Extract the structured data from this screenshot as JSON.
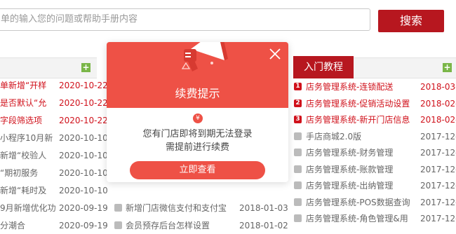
{
  "search": {
    "placeholder": "单的输入您的问题或帮助手册内容",
    "button_label": "搜索"
  },
  "left_panel": {
    "rows": [
      {
        "title": "单新增“开样",
        "date": "2020-10-22",
        "highlight": true
      },
      {
        "title": "是否默认“允",
        "date": "2020-10-22",
        "highlight": true
      },
      {
        "title": "字段筛选项",
        "date": "2020-10-22",
        "highlight": true
      },
      {
        "title": "小程序10月新",
        "date": "2020-10-10",
        "highlight": false
      },
      {
        "title": "新增“校验人",
        "date": "2020-10-10",
        "highlight": false
      },
      {
        "title": "“期初服务",
        "date": "2020-10-10",
        "highlight": false
      },
      {
        "title": "新增“耗时及",
        "date": "2020-10-10",
        "highlight": false
      },
      {
        "title": "9月新增优化功",
        "date": "2020-09-19",
        "highlight": false
      },
      {
        "title": "分潮合",
        "date": "2020-09-19",
        "highlight": false
      }
    ]
  },
  "middle_panel": {
    "rows": [
      {
        "title": "新增门店微信支付和支付宝",
        "date": "2018-01-03"
      },
      {
        "title": "会员预存后台怎样设置",
        "date": "2018-01-02"
      }
    ]
  },
  "right_panel": {
    "tab_label": "入门教程",
    "rows": [
      {
        "num": "1",
        "title": "店务管理系统-连锁配送",
        "date": "2018-03-",
        "highlight": true
      },
      {
        "num": "2",
        "title": "店务管理系统-促销活动设置",
        "date": "2018-02-",
        "highlight": true
      },
      {
        "num": "3",
        "title": "店务管理系统-新开门店信息",
        "date": "2018-02-",
        "highlight": true
      },
      {
        "num": "",
        "title": "手店商城2.0版",
        "date": "2017-12-",
        "highlight": false
      },
      {
        "num": "",
        "title": "店务管理系统-财务管理",
        "date": "2017-12-",
        "highlight": false
      },
      {
        "num": "",
        "title": "店务管理系统-账款管理",
        "date": "2017-12-",
        "highlight": false
      },
      {
        "num": "",
        "title": "店务管理系统-出纳管理",
        "date": "2017-12-",
        "highlight": false
      },
      {
        "num": "",
        "title": "店务管理系统-POS数据查询",
        "date": "2017-12-",
        "highlight": false
      },
      {
        "num": "",
        "title": "店务管理系统-角色管理&用",
        "date": "2017-12-",
        "highlight": false
      }
    ]
  },
  "modal": {
    "title": "续费提示",
    "message_line1": "您有门店即将到期无法登录",
    "message_line2": "需提前进行续费",
    "button_label": "立即查看",
    "yen_symbol": "¥",
    "accent_color": "#ee5146"
  }
}
